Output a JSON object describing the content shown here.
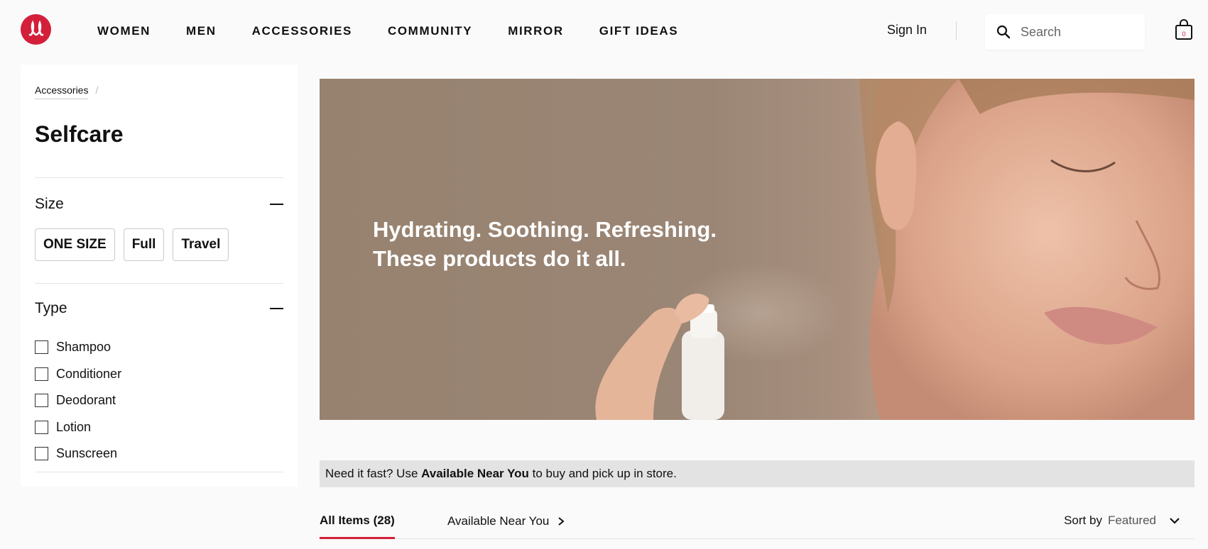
{
  "header": {
    "nav": [
      "WOMEN",
      "MEN",
      "ACCESSORIES",
      "COMMUNITY",
      "MIRROR",
      "GIFT IDEAS"
    ],
    "sign_in": "Sign In",
    "search_placeholder": "Search",
    "bag_count": "0"
  },
  "sidebar": {
    "breadcrumb": "Accessories",
    "breadcrumb_sep": "/",
    "title": "Selfcare",
    "size": {
      "label": "Size",
      "options": [
        "ONE SIZE",
        "Full",
        "Travel"
      ]
    },
    "type": {
      "label": "Type",
      "options": [
        "Shampoo",
        "Conditioner",
        "Deodorant",
        "Lotion",
        "Sunscreen"
      ]
    }
  },
  "hero": {
    "line1": "Hydrating. Soothing. Refreshing.",
    "line2": "These products do it all."
  },
  "notice": {
    "prefix": "Need it fast? Use ",
    "bold": "Available Near You",
    "suffix": " to buy and pick up in store."
  },
  "tabs": {
    "all_items": "All Items (28)",
    "near_you": "Available Near You"
  },
  "sort": {
    "label": "Sort by",
    "value": "Featured"
  },
  "colors": {
    "brand": "#d31f3a",
    "notice_bg": "#e3e3e3"
  }
}
